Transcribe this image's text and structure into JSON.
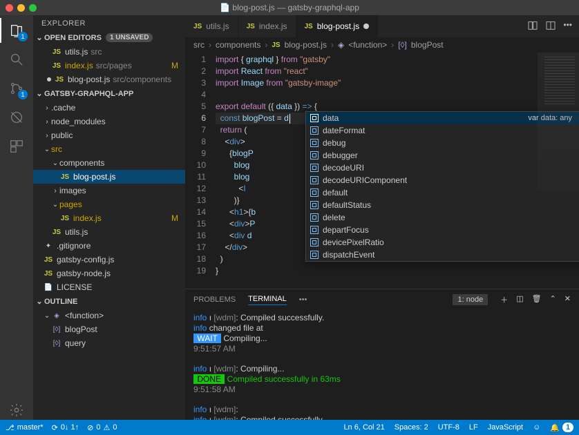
{
  "titlebar": {
    "filename": "blog-post.js",
    "project": "gatsby-graphql-app"
  },
  "activity": {
    "explorer_badge": "1",
    "scm_badge": "1"
  },
  "sidebar": {
    "title": "EXPLORER",
    "open_editors_label": "OPEN EDITORS",
    "unsaved_label": "1 UNSAVED",
    "open_editors": [
      {
        "name": "utils.js",
        "dim": "src",
        "modified": false,
        "dirty": false
      },
      {
        "name": "index.js",
        "dim": "src/pages",
        "modified": true,
        "dirty": false
      },
      {
        "name": "blog-post.js",
        "dim": "src/components",
        "modified": false,
        "dirty": true
      }
    ],
    "project_label": "GATSBY-GRAPHQL-APP",
    "tree": {
      "cache": ".cache",
      "node_modules": "node_modules",
      "public": "public",
      "src": "src",
      "components": "components",
      "blogpost": "blog-post.js",
      "images": "images",
      "pages": "pages",
      "indexjs": "index.js",
      "utilsjs": "utils.js",
      "gitignore": ".gitignore",
      "gatsbyconfig": "gatsby-config.js",
      "gatsbynode": "gatsby-node.js",
      "license": "LICENSE"
    },
    "outline_label": "OUTLINE",
    "outline": {
      "function": "<function>",
      "blogPost": "blogPost",
      "query": "query"
    }
  },
  "tabs": {
    "t0": "utils.js",
    "t1": "index.js",
    "t2": "blog-post.js"
  },
  "breadcrumbs": {
    "b0": "src",
    "b1": "components",
    "b2": "blog-post.js",
    "b3": "<function>",
    "b4": "blogPost"
  },
  "code": {
    "lines": [
      "import { graphql } from \"gatsby\"",
      "import React from \"react\"",
      "import Image from \"gatsby-image\"",
      "",
      "export default ({ data }) => {",
      "  const blogPost = d",
      "  return (",
      "    <div>",
      "      {blogP",
      "        blog",
      "        blog",
      "          <I",
      "        )}",
      "      <h1>{b",
      "      <div>P",
      "      <div d",
      "    </div>",
      "  )",
      "}"
    ]
  },
  "autocomplete": {
    "hint": "var data: any",
    "items": [
      "data",
      "dateFormat",
      "debug",
      "debugger",
      "decodeURI",
      "decodeURIComponent",
      "default",
      "defaultStatus",
      "delete",
      "departFocus",
      "devicePixelRatio",
      "dispatchEvent"
    ]
  },
  "panel": {
    "tabs": {
      "problems": "PROBLEMS",
      "terminal": "TERMINAL",
      "more": "•••"
    },
    "select": "1: node",
    "output": {
      "l1a": "info",
      "l1b": " ı ",
      "l1c": "[wdm]",
      "l1d": ": Compiled successfully.",
      "l2a": "info",
      "l2b": " changed file at",
      "l3a": " WAIT ",
      "l3b": " Compiling...",
      "l4": "9:51:57 AM",
      "l5a": "info",
      "l5b": " ı ",
      "l5c": "[wdm]",
      "l5d": ": Compiling...",
      "l6a": " DONE ",
      "l6b": " Compiled successfully in 63ms",
      "l7": "9:51:58 AM",
      "l8a": "info",
      "l8b": " ı ",
      "l8c": "[wdm]",
      "l8d": ":",
      "l9a": "info",
      "l9b": " ı ",
      "l9c": "[wdm]",
      "l9d": ": Compiled successfully."
    }
  },
  "status": {
    "branch": "master*",
    "sync": "0↓ 1↑",
    "errors": "0",
    "warnings": "0",
    "lncol": "Ln 6, Col 21",
    "spaces": "Spaces: 2",
    "encoding": "UTF-8",
    "eol": "LF",
    "lang": "JavaScript",
    "notif": "1"
  }
}
